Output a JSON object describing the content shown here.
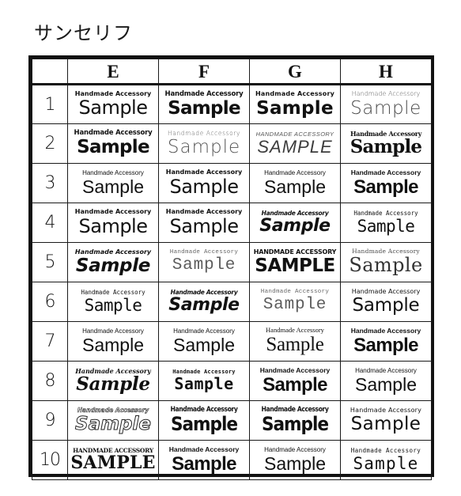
{
  "title": "サンセリフ",
  "table": {
    "corner_label": "",
    "column_headers": [
      "E",
      "F",
      "G",
      "H"
    ],
    "row_numbers": [
      "1",
      "2",
      "3",
      "4",
      "5",
      "6",
      "7",
      "8",
      "9",
      "10"
    ],
    "rows": [
      {
        "number": "1",
        "cells": [
          {
            "kicker": "Handmade Accessory",
            "word": "Sample",
            "style": "fs-geo"
          },
          {
            "kicker": "Handmade Accessory",
            "word": "Sample",
            "style": "fs-heavy"
          },
          {
            "kicker": "Handmade Accessory",
            "word": "Sample",
            "style": "fs-round"
          },
          {
            "kicker": "Handmade Accessory",
            "word": "Sample",
            "style": "fs-thin"
          }
        ]
      },
      {
        "number": "2",
        "cells": [
          {
            "kicker": "Handmade Accessory",
            "word": "Sample",
            "style": "fs-heavy"
          },
          {
            "kicker": "Handmade Accessory",
            "word": "Sample",
            "style": "fs-airy"
          },
          {
            "kicker": "HANDMADE ACCESSORY",
            "word": "SAMPLE",
            "style": "fs-italcap"
          },
          {
            "kicker": "Handmade Accessory",
            "word": "Sample",
            "style": "fs-fat"
          }
        ]
      },
      {
        "number": "3",
        "cells": [
          {
            "kicker": "Handmade Accessory",
            "word": "Sample",
            "style": "fs-light"
          },
          {
            "kicker": "Handmade Accessory",
            "word": "Sample",
            "style": "fs-geo"
          },
          {
            "kicker": "Handmade Accessory",
            "word": "Sample",
            "style": "fs-light"
          },
          {
            "kicker": "Handmade Accessory",
            "word": "Sample",
            "style": "fs-bold"
          }
        ]
      },
      {
        "number": "4",
        "cells": [
          {
            "kicker": "Handmade Accessory",
            "word": "Sample",
            "style": "fs-geo"
          },
          {
            "kicker": "Handmade Accessory",
            "word": "Sample",
            "style": "fs-geo"
          },
          {
            "kicker": "Handmade Accessory",
            "word": "Sample",
            "style": "fs-hand"
          },
          {
            "kicker": "Handmade Accessory",
            "word": "Sample",
            "style": "fs-mono"
          }
        ]
      },
      {
        "number": "5",
        "cells": [
          {
            "kicker": "Handmade Accessory",
            "word": "Sample",
            "style": "fs-oblique"
          },
          {
            "kicker": "Handmade Accessory",
            "word": "Sample",
            "style": "fs-monolight"
          },
          {
            "kicker": "HANDMADE ACCESSORY",
            "word": "SAMPLE",
            "style": "fs-boldcap"
          },
          {
            "kicker": "Handmade Accessory",
            "word": "Sample",
            "style": "fs-flare"
          }
        ]
      },
      {
        "number": "6",
        "cells": [
          {
            "kicker": "Handmade Accessory",
            "word": "Sample",
            "style": "fs-mono"
          },
          {
            "kicker": "Handmade Accessory",
            "word": "Sample",
            "style": "fs-hand"
          },
          {
            "kicker": "Handmade Accessory",
            "word": "Sample",
            "style": "fs-monolight"
          },
          {
            "kicker": "Handmade Accessory",
            "word": "Sample",
            "style": "fs-human"
          }
        ]
      },
      {
        "number": "7",
        "cells": [
          {
            "kicker": "Handmade Accessory",
            "word": "Sample",
            "style": "fs-light"
          },
          {
            "kicker": "Handmade Accessory",
            "word": "Sample",
            "style": "fs-light"
          },
          {
            "kicker": "Handmade Accessory",
            "word": "Sample",
            "style": "fs-flserif"
          },
          {
            "kicker": "Handmade Accessory",
            "word": "Sample",
            "style": "fs-bold"
          }
        ]
      },
      {
        "number": "8",
        "cells": [
          {
            "kicker": "Handmade Accessory",
            "word": "Sample",
            "style": "fs-script"
          },
          {
            "kicker": "Handmade Accessory",
            "word": "Sample",
            "style": "fs-marker"
          },
          {
            "kicker": "Handmade Accessory",
            "word": "Sample",
            "style": "fs-bold"
          },
          {
            "kicker": "Handmade Accessory",
            "word": "Sample",
            "style": "fs-light"
          }
        ]
      },
      {
        "number": "9",
        "cells": [
          {
            "kicker": "Handmade Accessory",
            "word": "Sample",
            "style": "fs-outline"
          },
          {
            "kicker": "Handmade Accessory",
            "word": "Sample",
            "style": "fs-cond"
          },
          {
            "kicker": "Handmade Accessory",
            "word": "Sample",
            "style": "fs-cond"
          },
          {
            "kicker": "Handmade Accessory",
            "word": "Sample",
            "style": "fs-odd"
          }
        ]
      },
      {
        "number": "10",
        "cells": [
          {
            "kicker": "HANDMADE ACCESSORY",
            "word": "SAMPLE",
            "style": "fs-slabcap"
          },
          {
            "kicker": "Handmade Accessory",
            "word": "Sample",
            "style": "fs-bold"
          },
          {
            "kicker": "Handmade Accessory",
            "word": "Sample",
            "style": "fs-light"
          },
          {
            "kicker": "Handmade Accessory",
            "word": "Sample",
            "style": "fs-wide"
          }
        ]
      }
    ]
  },
  "colors": {
    "border": "#111111",
    "text": "#111111",
    "background": "#ffffff",
    "muted_text": "#5a5a5a"
  }
}
